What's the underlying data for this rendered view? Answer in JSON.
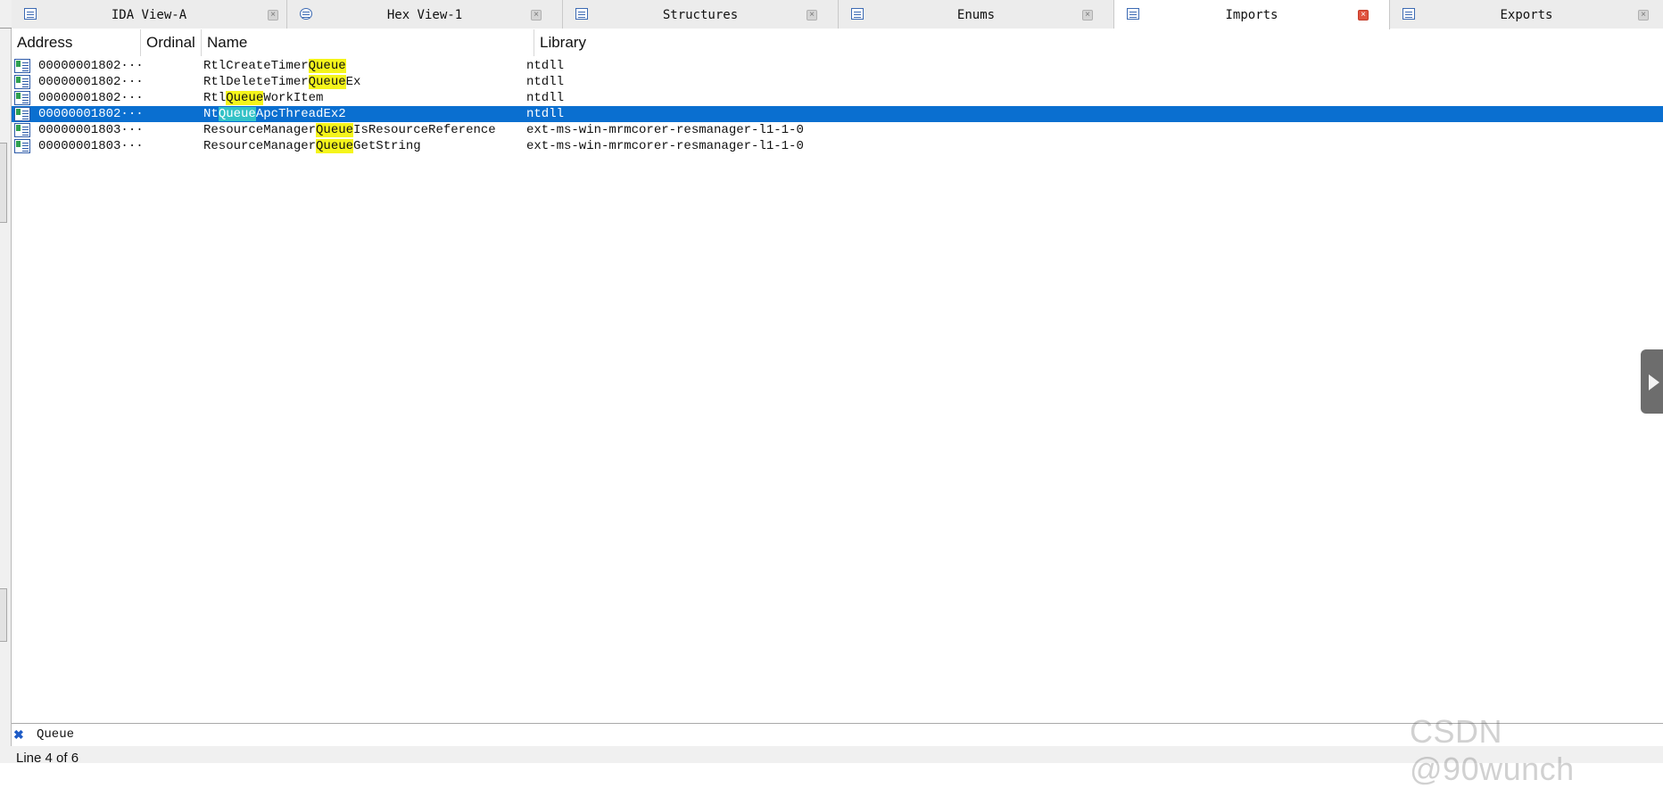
{
  "tabs": [
    {
      "label": "IDA View-A",
      "icon": "ida-view-icon",
      "active": false
    },
    {
      "label": "Hex View-1",
      "icon": "hex-view-icon",
      "active": false
    },
    {
      "label": "Structures",
      "icon": "structures-icon",
      "active": false
    },
    {
      "label": "Enums",
      "icon": "enums-icon",
      "active": false
    },
    {
      "label": "Imports",
      "icon": "imports-icon",
      "active": true
    },
    {
      "label": "Exports",
      "icon": "exports-icon",
      "active": false
    }
  ],
  "close_glyph": "×",
  "columns": {
    "address": "Address",
    "ordinal": "Ordinal",
    "name": "Name",
    "library": "Library"
  },
  "rows": [
    {
      "address": "00000001802···",
      "ordinal": "",
      "name_pre": "RtlCreateTimer",
      "name_hl": "Queue",
      "name_post": "",
      "library": "ntdll"
    },
    {
      "address": "00000001802···",
      "ordinal": "",
      "name_pre": "RtlDeleteTimer",
      "name_hl": "Queue",
      "name_post": "Ex",
      "library": "ntdll"
    },
    {
      "address": "00000001802···",
      "ordinal": "",
      "name_pre": "Rtl",
      "name_hl": "Queue",
      "name_post": "WorkItem",
      "library": "ntdll"
    },
    {
      "address": "00000001802···",
      "ordinal": "",
      "name_pre": "Nt",
      "name_hl": "Queue",
      "name_post": "ApcThreadEx2",
      "library": "ntdll",
      "selected": true
    },
    {
      "address": "00000001803···",
      "ordinal": "",
      "name_pre": "ResourceManager",
      "name_hl": "Queue",
      "name_post": "IsResourceReference",
      "library": "ext-ms-win-mrmcorer-resmanager-l1-1-0"
    },
    {
      "address": "00000001803···",
      "ordinal": "",
      "name_pre": "ResourceManager",
      "name_hl": "Queue",
      "name_post": "GetString",
      "library": "ext-ms-win-mrmcorer-resmanager-l1-1-0"
    }
  ],
  "search": {
    "value": "Queue",
    "clear_glyph": "✖"
  },
  "status": {
    "text": "Line 4 of 6"
  },
  "watermark": "CSDN @90wunch",
  "colors": {
    "selection": "#0a6fd0",
    "highlight": "#f5f51b",
    "highlight_selected": "#33c2c7",
    "active_close": "#e0533f"
  }
}
